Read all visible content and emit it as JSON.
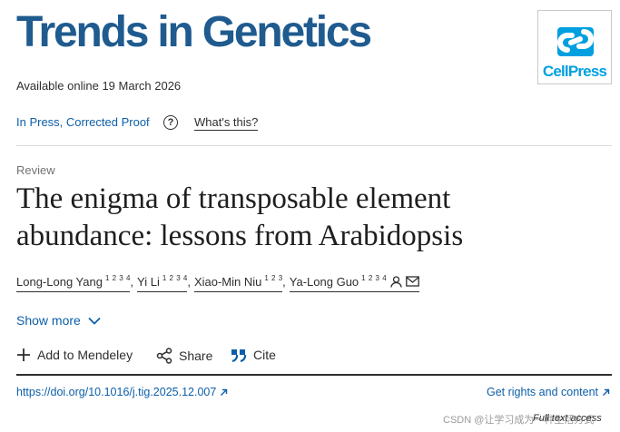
{
  "header": {
    "journal_title": "Trends in Genetics",
    "publisher_logo_text": "CellPress",
    "available_online": "Available online 19 March 2026"
  },
  "status": {
    "label": "In Press, Corrected Proof",
    "help_label": "What's this?",
    "help_icon_glyph": "?"
  },
  "article": {
    "type": "Review",
    "title": "The enigma of transposable element abundance: lessons from Arabidopsis",
    "authors": [
      {
        "name": "Long-Long Yang",
        "affiliations": "1 2 3 4"
      },
      {
        "name": "Yi Li",
        "affiliations": "1 2 3 4"
      },
      {
        "name": "Xiao-Min Niu",
        "affiliations": "1 2 3"
      },
      {
        "name": "Ya-Long Guo",
        "affiliations": "1 2 3 4"
      }
    ],
    "show_more_label": "Show more"
  },
  "actions": {
    "add_to_mendeley": "Add to Mendeley",
    "share": "Share",
    "cite": "Cite"
  },
  "links": {
    "doi": "https://doi.org/10.1016/j.tig.2025.12.007",
    "rights": "Get rights and content"
  },
  "footer": {
    "watermark": "CSDN @让学习成为一种生活方式",
    "access": "Full text access"
  },
  "colors": {
    "journal_blue": "#1f5b8f",
    "link_blue": "#0c5fa8",
    "cellpress_blue": "#00a0e0"
  }
}
